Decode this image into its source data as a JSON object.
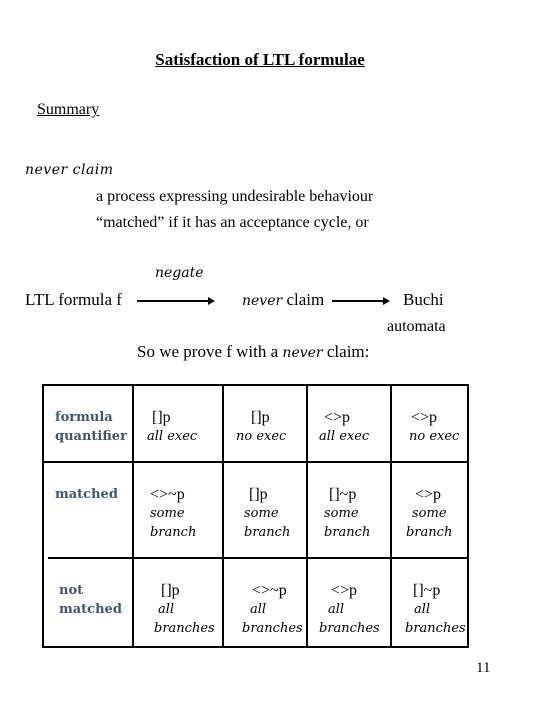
{
  "title": "Satisfaction of LTL formulae",
  "summary_heading": "Summary",
  "never_claim": {
    "term": "never claim",
    "definition_lines": [
      "a process expressing undesirable behaviour",
      "“matched” if it has an acceptance cycle, or"
    ]
  },
  "flow": {
    "arrow_label": "negate",
    "source": "LTL formula f",
    "middle_italic": "never",
    "middle_rest": " claim",
    "target_line1": "Buchi",
    "target_line2": "automata"
  },
  "proof_sentence": {
    "before": "So we prove f with a ",
    "italic": "never",
    "after": " claim:"
  },
  "table": {
    "row_headers": [
      [
        "formula",
        "quantifier"
      ],
      [
        "matched"
      ],
      [
        "not",
        "matched"
      ]
    ],
    "columns": [
      {
        "formula": "[]p",
        "quantifier": "all exec",
        "matched_formula": "<>~p",
        "matched_text": [
          "some",
          "branch"
        ],
        "not_matched_formula": "[]p",
        "not_matched_text": [
          "all",
          "branches"
        ]
      },
      {
        "formula": "[]p",
        "quantifier": "no exec",
        "matched_formula": "[]p",
        "matched_text": [
          "some",
          "branch"
        ],
        "not_matched_formula": "<>~p",
        "not_matched_text": [
          "all",
          "branches"
        ]
      },
      {
        "formula": "<>p",
        "quantifier": "all exec",
        "matched_formula": "[]~p",
        "matched_text": [
          "some",
          "branch"
        ],
        "not_matched_formula": "<>p",
        "not_matched_text": [
          "all",
          "branches"
        ]
      },
      {
        "formula": "<>p",
        "quantifier": "no exec",
        "matched_formula": "<>p",
        "matched_text": [
          "some",
          "branch"
        ],
        "not_matched_formula": "[]~p",
        "not_matched_text": [
          "all",
          "branches"
        ]
      }
    ]
  },
  "page_number": "11",
  "colors": {
    "row_header_text": "#3f5670",
    "text": "#000000",
    "background": "#ffffff"
  }
}
